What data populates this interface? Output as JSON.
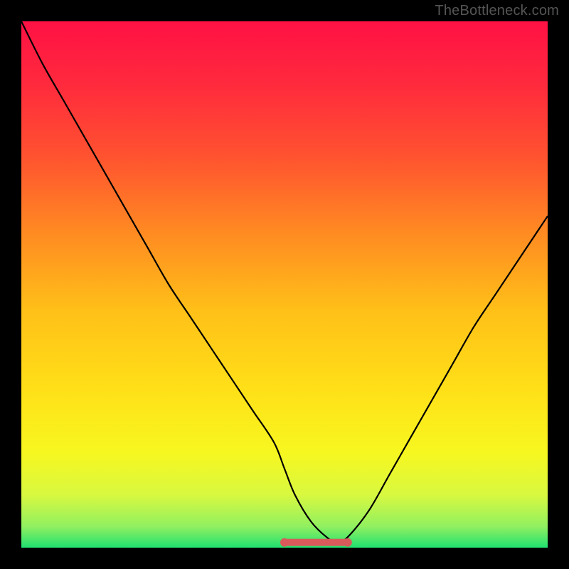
{
  "watermark": "TheBottleneck.com",
  "chart_data": {
    "type": "line",
    "title": "",
    "xlabel": "",
    "ylabel": "",
    "xlim": [
      0,
      100
    ],
    "ylim": [
      0,
      100
    ],
    "x": [
      0,
      4,
      8,
      12,
      16,
      20,
      24,
      28,
      32,
      36,
      40,
      44,
      48,
      50,
      52,
      55,
      58,
      60,
      62,
      66,
      70,
      74,
      78,
      82,
      86,
      90,
      94,
      98,
      100
    ],
    "values": [
      100,
      92,
      85,
      78,
      71,
      64,
      57,
      50,
      44,
      38,
      32,
      26,
      20,
      15,
      10,
      5,
      2,
      1,
      2,
      7,
      14,
      21,
      28,
      35,
      42,
      48,
      54,
      60,
      63
    ],
    "gradient_stops": [
      {
        "offset": 0.0,
        "color": "#ff1144"
      },
      {
        "offset": 0.12,
        "color": "#ff2a3d"
      },
      {
        "offset": 0.25,
        "color": "#ff5030"
      },
      {
        "offset": 0.4,
        "color": "#ff8a22"
      },
      {
        "offset": 0.55,
        "color": "#ffc018"
      },
      {
        "offset": 0.7,
        "color": "#ffe018"
      },
      {
        "offset": 0.82,
        "color": "#f7f720"
      },
      {
        "offset": 0.9,
        "color": "#d8f840"
      },
      {
        "offset": 0.96,
        "color": "#90f060"
      },
      {
        "offset": 1.0,
        "color": "#20e070"
      }
    ],
    "trough_marker": {
      "x_start": 50,
      "x_end": 62,
      "y": 1,
      "color": "#d85a5a",
      "thickness": 10
    }
  }
}
